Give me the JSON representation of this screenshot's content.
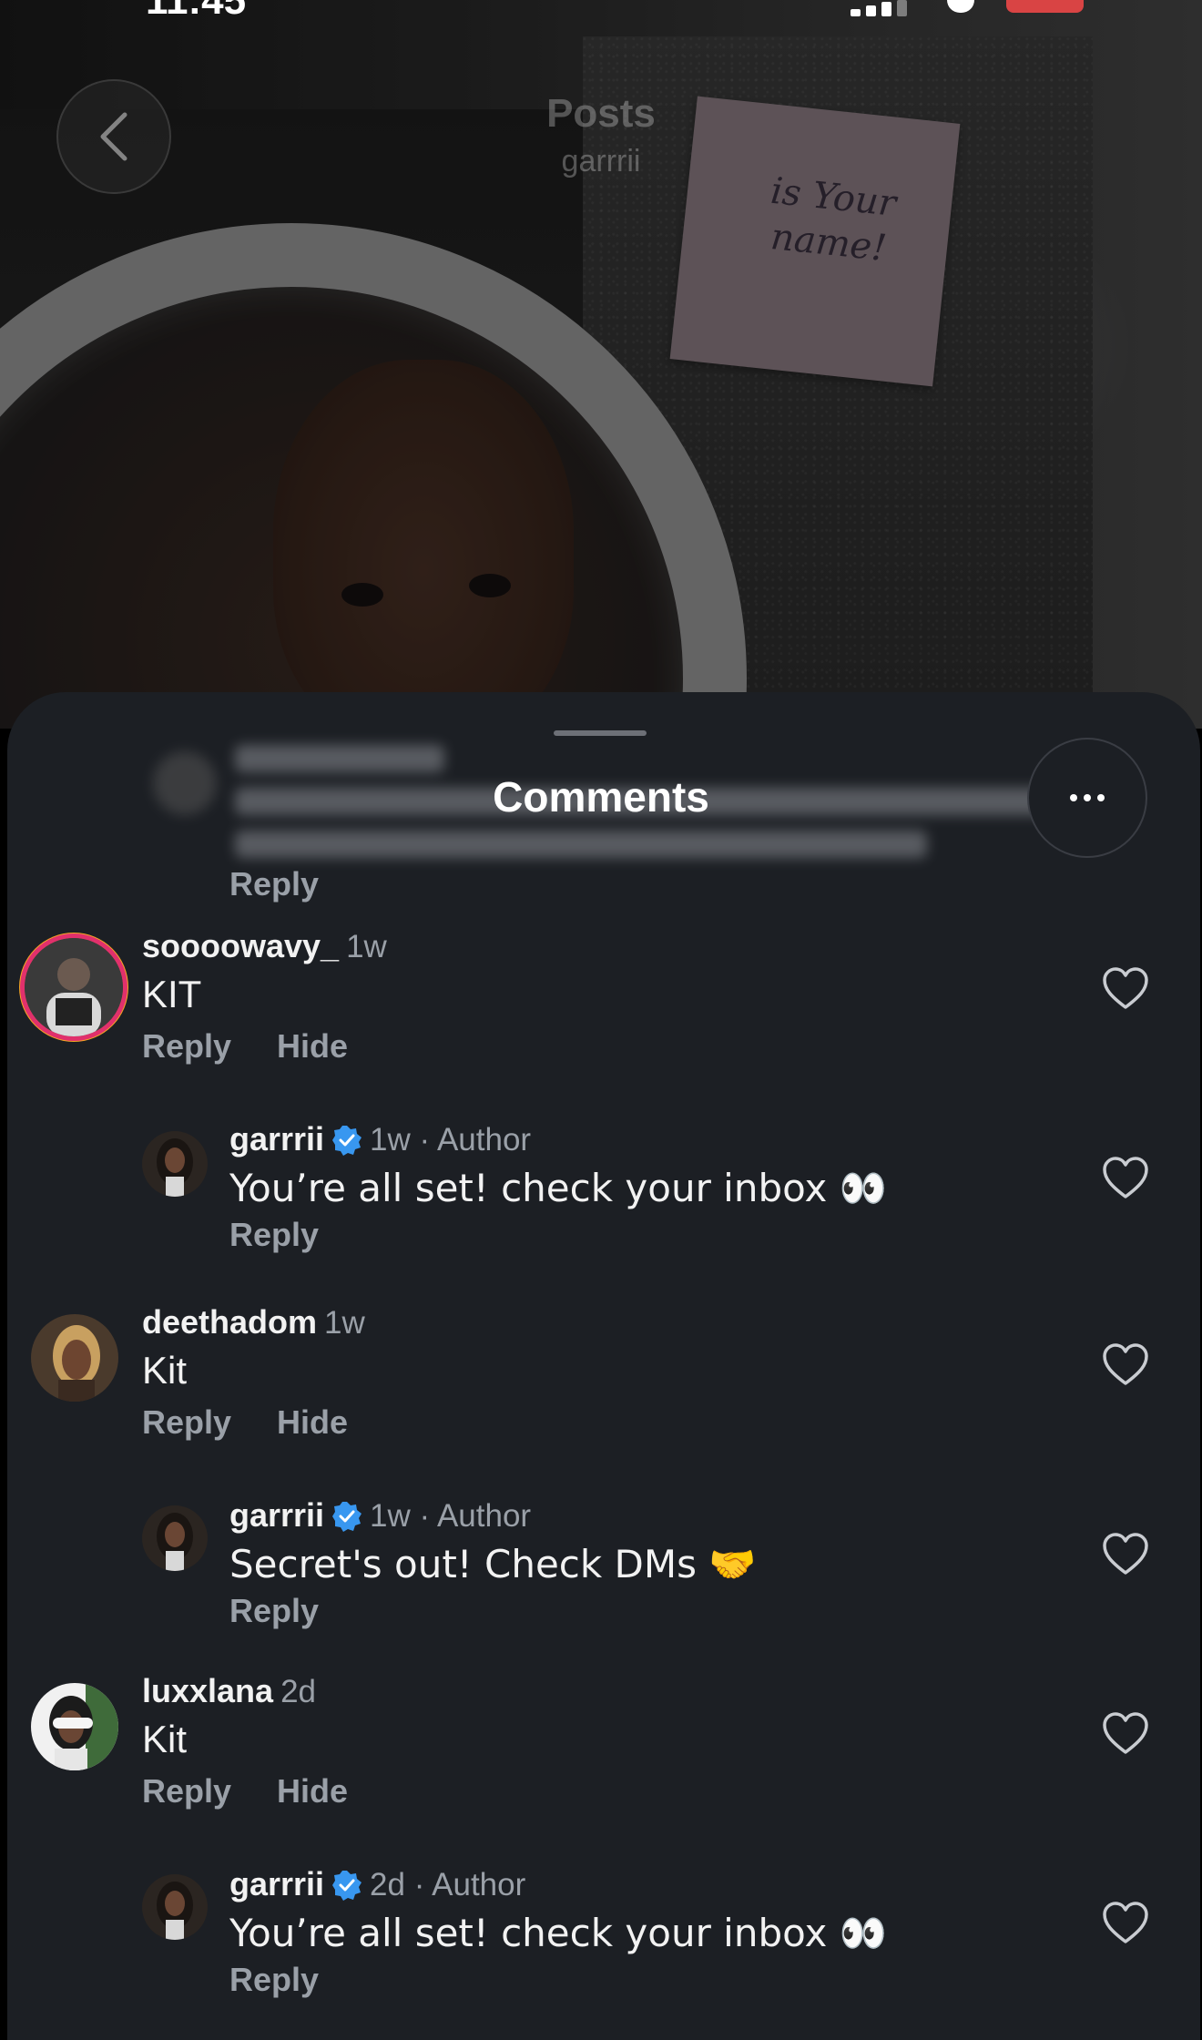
{
  "status_bar": {
    "time": "11:45"
  },
  "header": {
    "title": "Posts",
    "subtitle": "garrrii"
  },
  "post_image": {
    "sticky_note_text": "is Your name!"
  },
  "sheet": {
    "title": "Comments",
    "top_reply_label": "Reply"
  },
  "comments": [
    {
      "username": "soooowavy_",
      "time": "1w",
      "text": "KIT",
      "reply_label": "Reply",
      "hide_label": "Hide",
      "reply": {
        "username": "garrrii",
        "meta": "1w · Author",
        "text": "You’re all set! check your inbox 👀",
        "reply_label": "Reply"
      }
    },
    {
      "username": "deethadom",
      "time": "1w",
      "text": "Kit",
      "reply_label": "Reply",
      "hide_label": "Hide",
      "reply": {
        "username": "garrrii",
        "meta": "1w · Author",
        "text": "Secret's out! Check DMs 🤝",
        "reply_label": "Reply"
      }
    },
    {
      "username": "luxxlana",
      "time": "2d",
      "text": "Kit",
      "reply_label": "Reply",
      "hide_label": "Hide",
      "reply": {
        "username": "garrrii",
        "meta": "2d · Author",
        "text": "You’re all set! check your inbox 👀",
        "reply_label": "Reply"
      }
    }
  ],
  "colors": {
    "sheet_bg": "#1c1f24",
    "verified": "#3897f0",
    "muted_text": "#9aa0a8"
  }
}
